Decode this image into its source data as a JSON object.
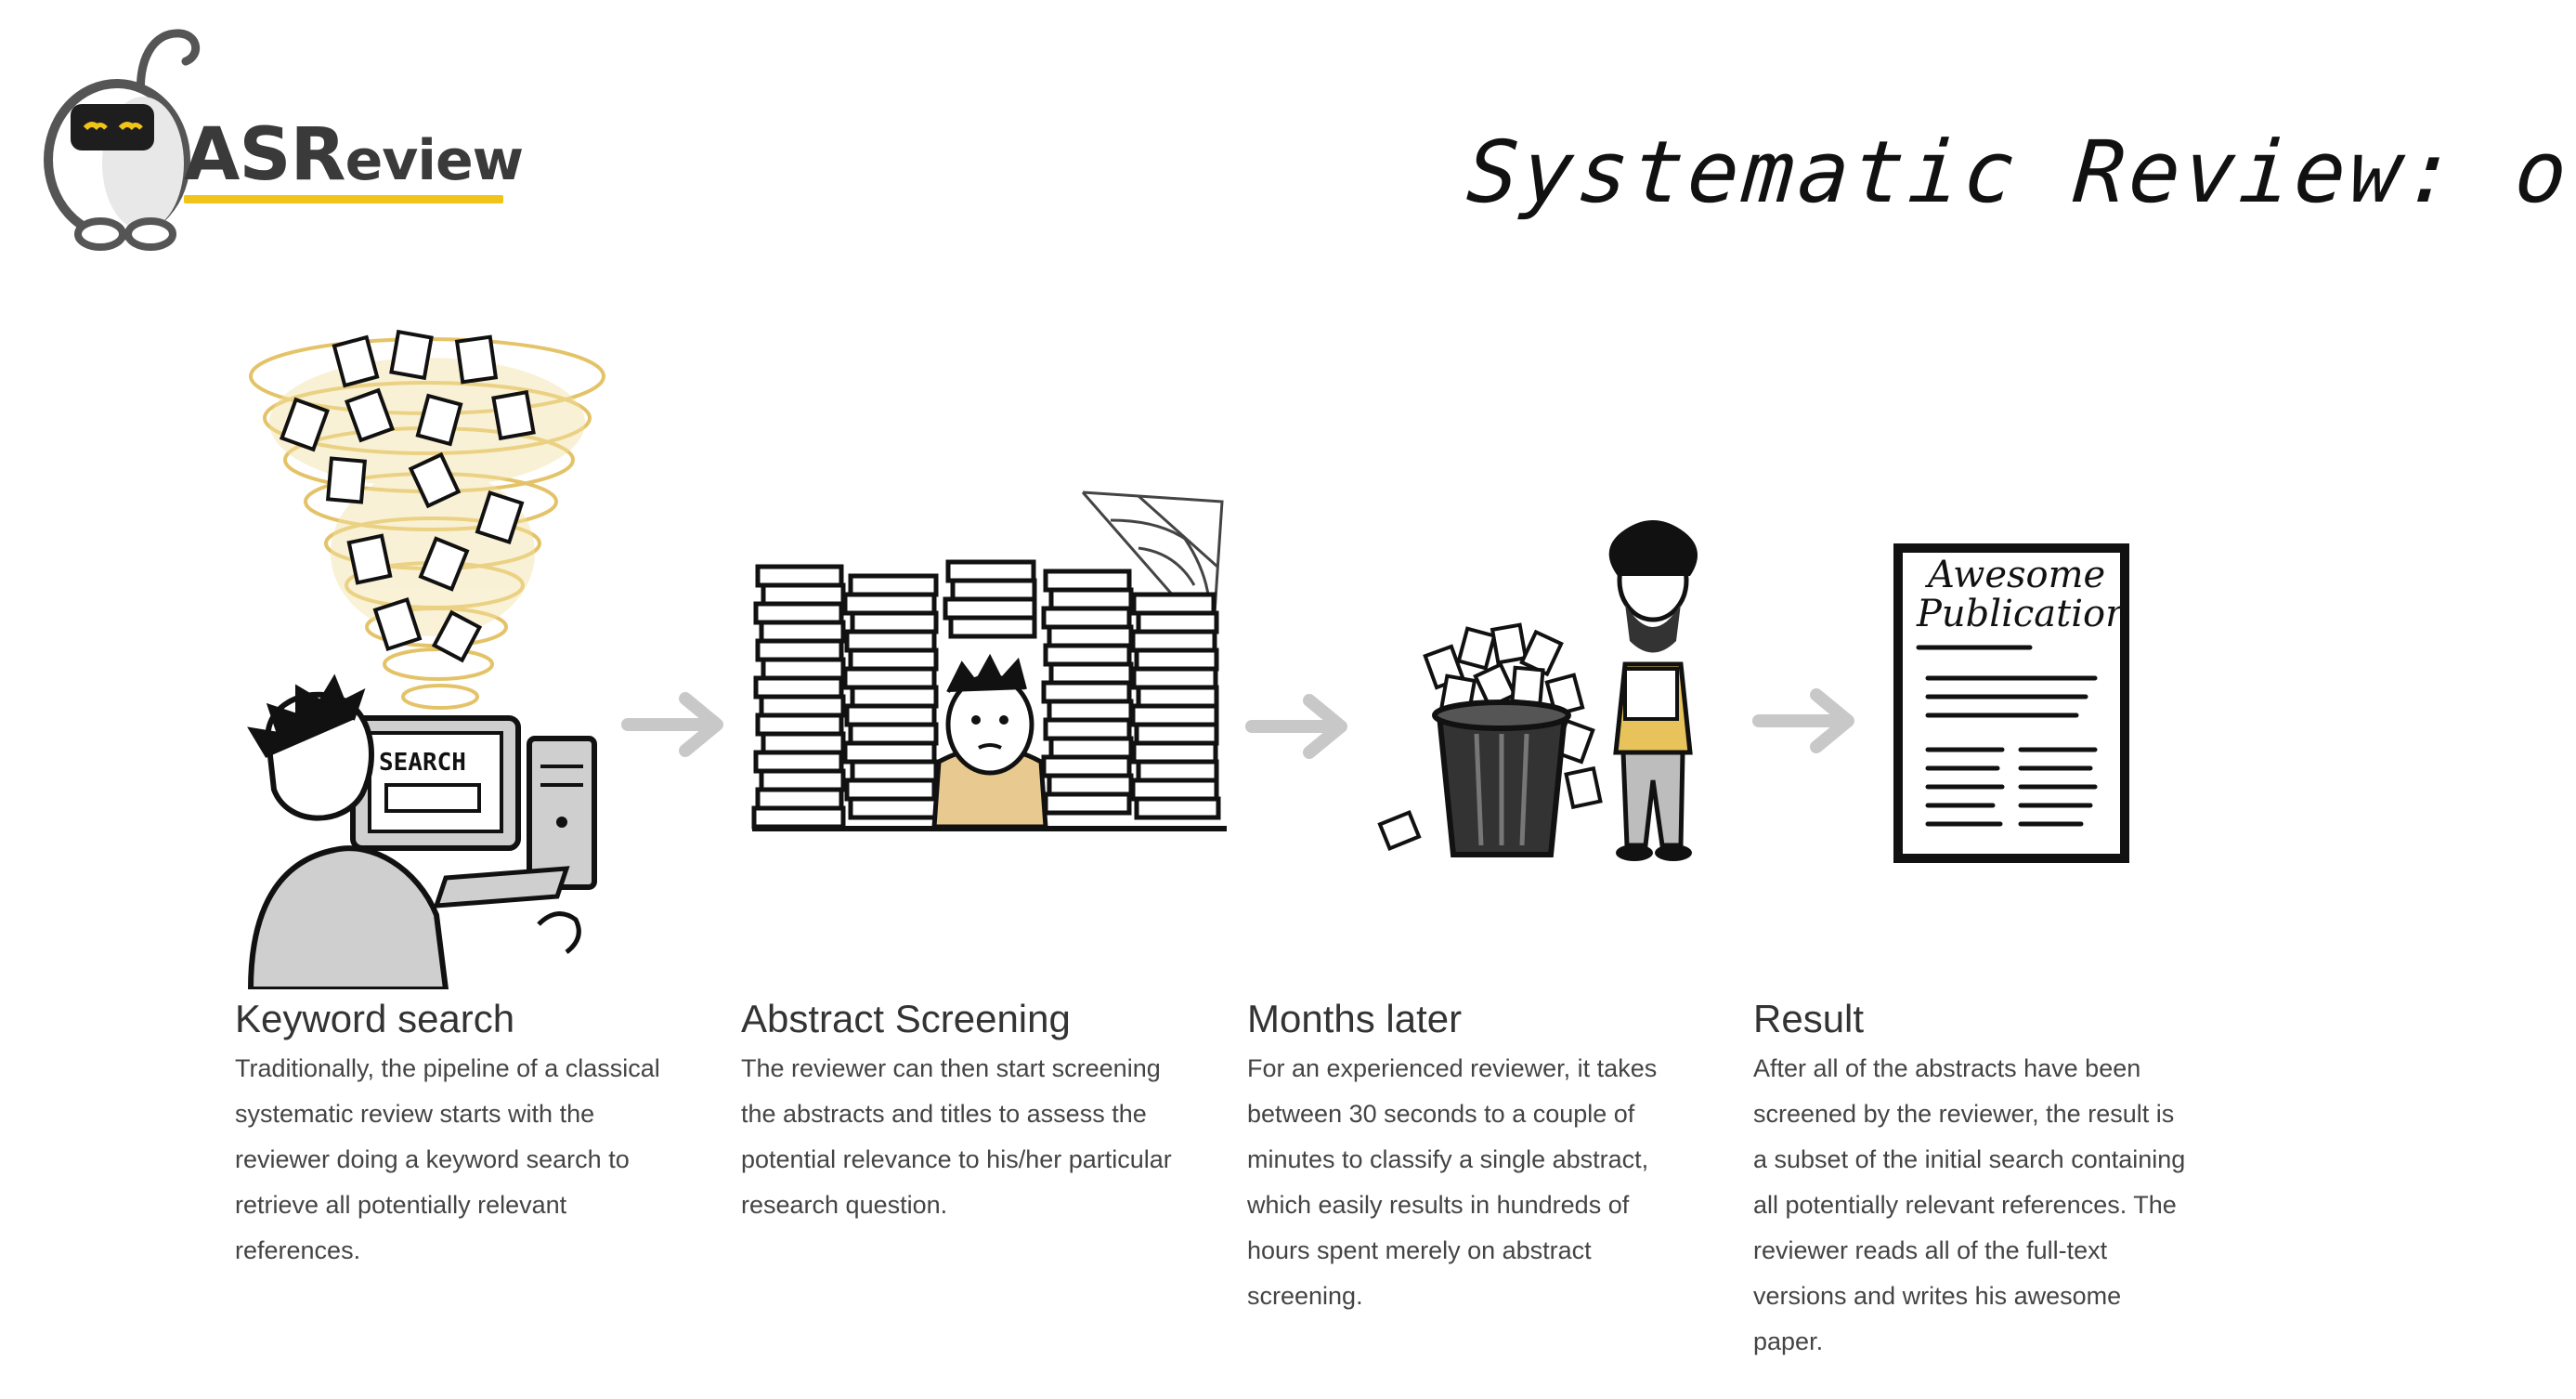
{
  "logo": {
    "text_main": "ASR",
    "text_rest": "eview",
    "accent": "#f0c419"
  },
  "title": "Systematic Review: old skool",
  "illustrations": {
    "search_label": "SEARCH",
    "paper_title_1": "Awesome",
    "paper_title_2": "Publication"
  },
  "steps": [
    {
      "heading": "Keyword search",
      "text": "Traditionally, the pipeline of a classical systematic review starts with the reviewer doing a keyword search to retrieve all potentially relevant references."
    },
    {
      "heading": "Abstract Screening",
      "text": "The reviewer can then start screening the abstracts and titles to assess the potential relevance to his/her particular research question."
    },
    {
      "heading": "Months later",
      "text": "For an experienced reviewer, it takes between 30 seconds to a couple of minutes to classify a single abstract, which easily results in hundreds of hours spent merely on abstract screening."
    },
    {
      "heading": "Result",
      "text": "After all of the abstracts have been screened by the reviewer, the result is a subset of the initial search containing all potentially relevant references. The reviewer reads all of the full-text versions and writes his awesome paper."
    }
  ],
  "colors": {
    "arrow": "#c8c8c8",
    "accent_yellow": "#e8c25a",
    "ink": "#111111",
    "gray": "#bdbdbd"
  }
}
